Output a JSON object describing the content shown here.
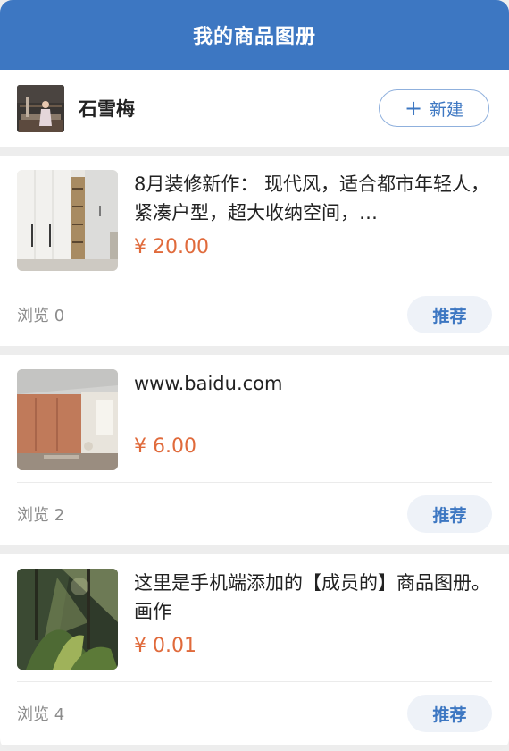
{
  "header": {
    "title": "我的商品图册"
  },
  "user": {
    "name": "石雪梅",
    "new_button_label": "新建",
    "new_button_icon": "plus-icon"
  },
  "colors": {
    "brand": "#3d77c2",
    "price": "#e06a3b",
    "muted": "#8c8c8c"
  },
  "items": [
    {
      "description": "8月装修新作：  现代风，适合都市年轻人，紧凑户型，超大收纳空间，…",
      "price": "¥ 20.00",
      "views": "浏览 0",
      "recommend_label": "推荐"
    },
    {
      "description": "www.baidu.com",
      "price": "¥ 6.00",
      "views": "浏览 2",
      "recommend_label": "推荐"
    },
    {
      "description": "这里是手机端添加的【成员的】商品图册。画作",
      "price": "¥ 0.01",
      "views": "浏览 4",
      "recommend_label": "推荐"
    }
  ]
}
